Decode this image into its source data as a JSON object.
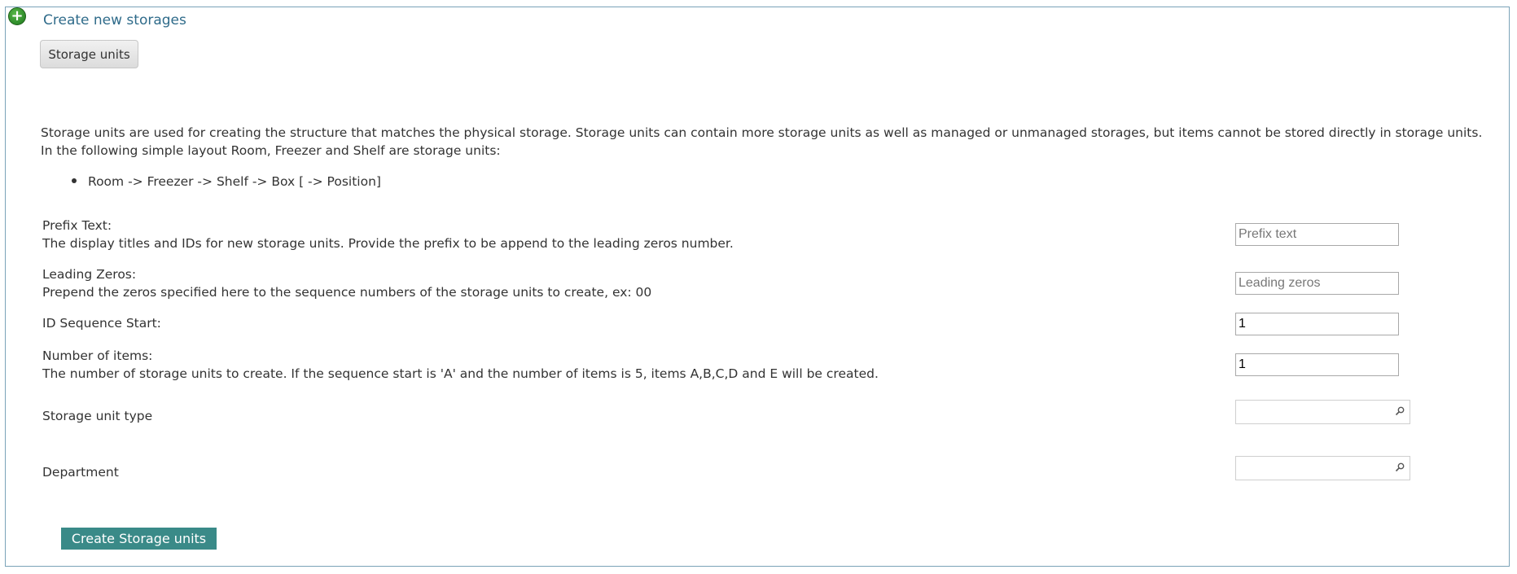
{
  "panel": {
    "title": "Create new storages",
    "tab_label": "Storage units"
  },
  "description": {
    "paragraph": "Storage units are used for creating the structure that matches the physical storage. Storage units can contain more storage units as well as managed or unmanaged storages, but items cannot be stored directly in storage units. In the following simple layout Room, Freezer and Shelf are storage units:",
    "list_item": "Room -> Freezer -> Shelf -> Box [ -> Position]"
  },
  "fields": {
    "prefix": {
      "label": "Prefix Text:",
      "help": "The display titles and IDs for new storage units. Provide the prefix to be append to the leading zeros number.",
      "value": "",
      "placeholder": "Prefix text"
    },
    "leading_zeros": {
      "label": "Leading Zeros:",
      "help": "Prepend the zeros specified here to the sequence numbers of the storage units to create, ex: 00",
      "value": "",
      "placeholder": "Leading zeros"
    },
    "id_start": {
      "label": "ID Sequence Start:",
      "value": "1"
    },
    "num_items": {
      "label": "Number of items:",
      "help": "The number of storage units to create. If the sequence start is 'A' and the number of items is 5, items A,B,C,D and E will be created.",
      "value": "1"
    },
    "unit_type": {
      "label": "Storage unit type",
      "value": ""
    },
    "department": {
      "label": "Department",
      "value": ""
    }
  },
  "actions": {
    "submit_label": "Create Storage units"
  },
  "icons": {
    "header": "plus-circle-icon",
    "lookup": "search-icon"
  },
  "colors": {
    "panel_border": "#7aa3b8",
    "title": "#2f6b8a",
    "submit_bg": "#3a8a88",
    "plus_icon": "#2e8b2a"
  }
}
